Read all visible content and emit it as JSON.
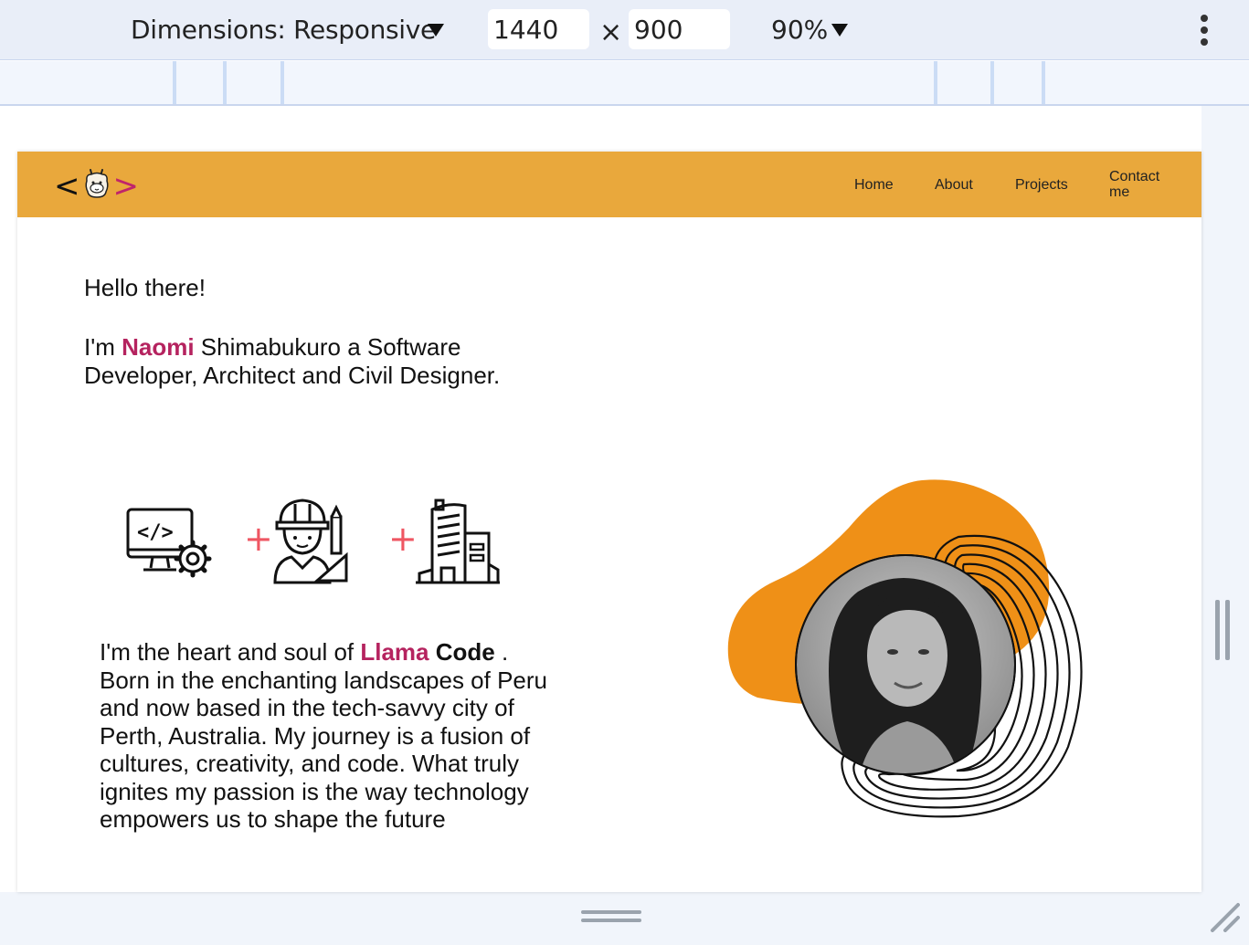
{
  "devtools": {
    "dimensions_label": "Dimensions: Responsive",
    "width_value": "1440",
    "times_symbol": "×",
    "height_value": "900",
    "zoom_value": "90%",
    "more_icon": "kebab-menu-icon"
  },
  "page": {
    "colors": {
      "navbar": "#e9a83c",
      "accent": "#b5235f",
      "plus": "#ef5662",
      "blob": "#ef9017"
    },
    "logo": {
      "left_bracket": "<",
      "right_bracket": ">",
      "icon": "llama-icon"
    },
    "nav": {
      "home": "Home",
      "about": "About",
      "projects": "Projects",
      "contact_line1": "Contact",
      "contact_line2": "me"
    },
    "greeting": "Hello there!",
    "intro": {
      "prefix": "I'm ",
      "first_name": "Naomi",
      "rest_line1": " Shimabukuro a Software",
      "rest_line2": "Developer, Architect and Civil Designer."
    },
    "icons": {
      "developer": "developer-computer-gear-icon",
      "plus": "+",
      "engineer": "civil-engineer-icon",
      "building": "building-icon"
    },
    "about": {
      "p1": "I'm the heart and soul of ",
      "brand1": "Llama",
      "brand2": "Code",
      "rest": " . Born in the enchanting landscapes of Peru and now based in the tech-savvy city of Perth, Australia. My journey is a fusion of cultures, creativity, and code. What truly ignites my passion is the way technology empowers us to shape the future"
    },
    "hero": {
      "photo": "profile-photo",
      "blob": "orange-blob",
      "rings": "contour-rings"
    }
  }
}
